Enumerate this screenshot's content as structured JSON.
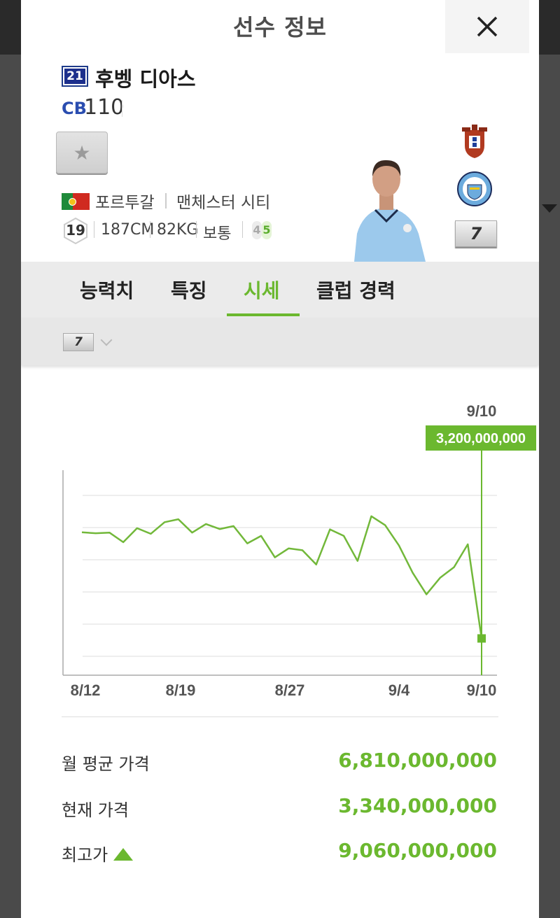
{
  "modal": {
    "title": "선수 정보",
    "close_icon": "close-icon"
  },
  "player": {
    "season_code": "21",
    "name": "후벵 디아스",
    "position": "CB",
    "ovr": "110",
    "nation": "포르투갈",
    "club": "맨체스터 시티",
    "age": "19",
    "height": "187CM",
    "weight": "82KG",
    "body_type": "보통",
    "weak_foot": "4",
    "strong_foot": "5",
    "grade": "7"
  },
  "tabs": [
    {
      "label": "능력치",
      "active": false
    },
    {
      "label": "특징",
      "active": false
    },
    {
      "label": "시세",
      "active": true
    },
    {
      "label": "클럽 경력",
      "active": false
    }
  ],
  "grade_selector": {
    "value": "7"
  },
  "chart_data": {
    "type": "line",
    "x_labels": [
      "8/12",
      "8/19",
      "8/27",
      "9/4",
      "9/10"
    ],
    "series": [
      {
        "values": [
          6.76,
          6.73,
          6.75,
          6.43,
          6.9,
          6.71,
          7.1,
          7.2,
          6.75,
          7.04,
          6.87,
          6.97,
          6.39,
          6.64,
          5.92,
          6.22,
          6.16,
          5.68,
          6.86,
          6.64,
          5.8,
          7.3,
          7.0,
          6.32,
          5.4,
          4.68,
          5.24,
          5.59,
          6.36,
          3.2
        ]
      }
    ],
    "highlight": {
      "label": "9/10",
      "value": "3,200,000,000"
    },
    "grid": true,
    "colors": {
      "line": "#72b83a",
      "highlight": "#6bb82f"
    }
  },
  "stats": [
    {
      "label": "월 평균 가격",
      "value": "6,810,000,000"
    },
    {
      "label": "현재 가격",
      "value": "3,340,000,000"
    },
    {
      "label": "최고가",
      "value": "9,060,000,000"
    }
  ]
}
